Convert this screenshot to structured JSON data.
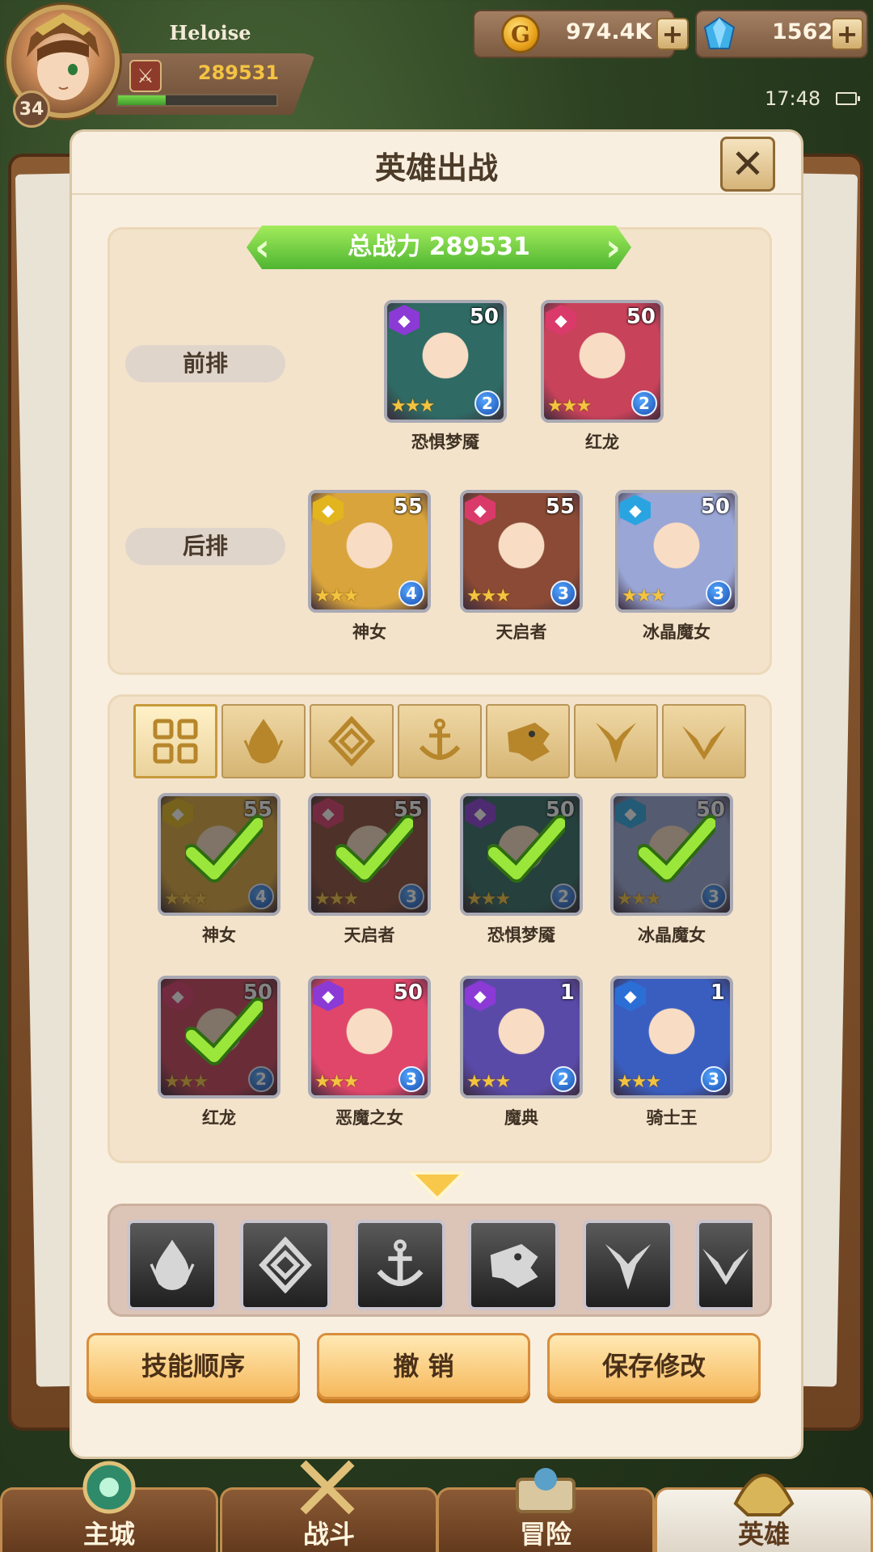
{
  "player": {
    "name": "Heloise",
    "level": "34",
    "power": "289531",
    "exp_fraction": 0.3
  },
  "resources": {
    "gold": "974.4K",
    "gems": "1562",
    "gold_icon": "gold-coin-icon",
    "gem_icon": "diamond-icon"
  },
  "status": {
    "time": "17:48"
  },
  "panel": {
    "title": "英雄出战",
    "total_power_label": "总战力  289531",
    "front_row_label": "前排",
    "back_row_label": "后排"
  },
  "formation": {
    "front": [
      {
        "name": "恐惧梦魇",
        "level": "50",
        "rank": "2",
        "stars": "★★★",
        "faction_color": "#8b3ad6",
        "bg": "#2f6a64"
      },
      {
        "name": "红龙",
        "level": "50",
        "rank": "2",
        "stars": "★★★",
        "faction_color": "#d93a6a",
        "bg": "#c8425a"
      }
    ],
    "back": [
      {
        "name": "神女",
        "level": "55",
        "rank": "4",
        "stars": "★★★",
        "faction_color": "#e2b51e",
        "bg": "#d9a43c"
      },
      {
        "name": "天启者",
        "level": "55",
        "rank": "3",
        "stars": "★★★",
        "faction_color": "#d93a6a",
        "bg": "#8a4a35"
      },
      {
        "name": "冰晶魔女",
        "level": "50",
        "rank": "3",
        "stars": "★★★",
        "faction_color": "#2aa4e0",
        "bg": "#9aa6d6"
      }
    ]
  },
  "roster": [
    {
      "name": "神女",
      "level": "55",
      "rank": "4",
      "stars": "★★★",
      "selected": true,
      "faction_color": "#e2b51e",
      "bg": "#d9a43c"
    },
    {
      "name": "天启者",
      "level": "55",
      "rank": "3",
      "stars": "★★★",
      "selected": true,
      "faction_color": "#d93a6a",
      "bg": "#8a4a35"
    },
    {
      "name": "恐惧梦魇",
      "level": "50",
      "rank": "2",
      "stars": "★★★",
      "selected": true,
      "faction_color": "#8b3ad6",
      "bg": "#2f6a64"
    },
    {
      "name": "冰晶魔女",
      "level": "50",
      "rank": "3",
      "stars": "★★★",
      "selected": true,
      "faction_color": "#2aa4e0",
      "bg": "#9aa6d6"
    },
    {
      "name": "红龙",
      "level": "50",
      "rank": "2",
      "stars": "★★★",
      "selected": true,
      "faction_color": "#d93a6a",
      "bg": "#c8425a"
    },
    {
      "name": "恶魔之女",
      "level": "50",
      "rank": "3",
      "stars": "★★★",
      "selected": false,
      "faction_color": "#8b3ad6",
      "bg": "#e0466a"
    },
    {
      "name": "魔典",
      "level": "1",
      "rank": "2",
      "stars": "★★★",
      "selected": false,
      "faction_color": "#8b3ad6",
      "bg": "#5a4aa8"
    },
    {
      "name": "骑士王",
      "level": "1",
      "rank": "3",
      "stars": "★★★",
      "selected": false,
      "faction_color": "#2b6fd6",
      "bg": "#3a5ec0"
    }
  ],
  "filter_tabs": [
    "all-grid-icon",
    "flame-faction-icon",
    "crystal-faction-icon",
    "anchor-faction-icon",
    "beast-faction-icon",
    "demon-faction-icon",
    "light-faction-icon"
  ],
  "faction_buttons": [
    "flame-faction-icon",
    "crystal-faction-icon",
    "anchor-faction-icon",
    "beast-faction-icon",
    "demon-faction-icon",
    "light-faction-icon"
  ],
  "actions": {
    "skill_order": "技能顺序",
    "undo": "撤 销",
    "save": "保存修改"
  },
  "nav": {
    "city": "主城",
    "battle": "战斗",
    "adventure": "冒险",
    "heroes": "英雄"
  }
}
